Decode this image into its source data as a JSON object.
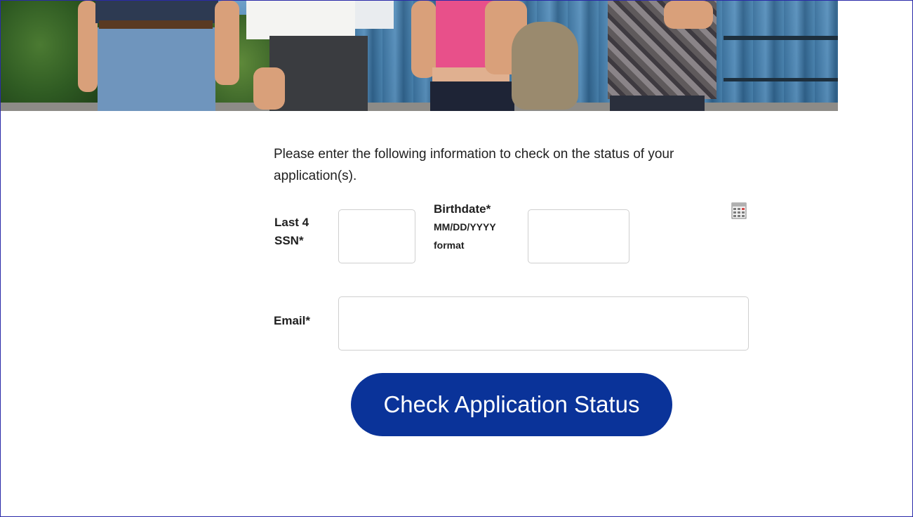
{
  "intro": {
    "text": "Please enter the following information to check on the status of your application(s)."
  },
  "form": {
    "ssn_label": "Last 4 SSN*",
    "ssn_value": "",
    "birthdate_label": "Birthdate*",
    "birthdate_format": "MM/DD/YYYY format",
    "birthdate_value": "",
    "email_label": "Email*",
    "email_value": "",
    "calendar_icon": "calendar-icon",
    "submit_label": "Check Application Status"
  },
  "colors": {
    "button": "#0a3399",
    "frame_border": "#2a2aa8"
  }
}
